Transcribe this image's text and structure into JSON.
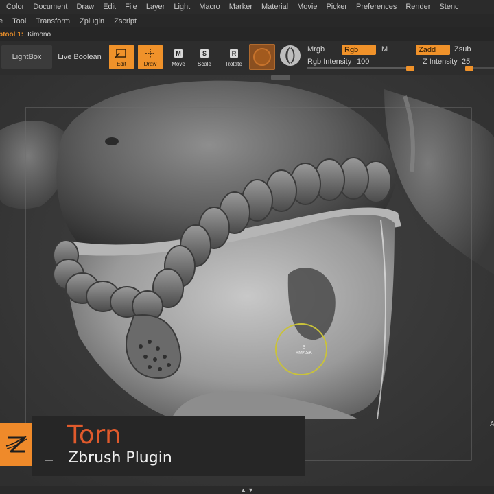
{
  "menu": {
    "items": [
      "Color",
      "Document",
      "Draw",
      "Edit",
      "File",
      "Layer",
      "Light",
      "Macro",
      "Marker",
      "Material",
      "Movie",
      "Picker",
      "Preferences",
      "Render",
      "Stenc"
    ]
  },
  "submenu": {
    "items": [
      "e",
      "Tool",
      "Transform",
      "Zplugin",
      "Zscript"
    ]
  },
  "subtool": {
    "label": "btool 1:",
    "name": "Kimono"
  },
  "toolbar": {
    "lightbox": "LightBox",
    "live_boolean": "Live Boolean",
    "edit": "Edit",
    "draw": "Draw",
    "move": "Move",
    "move_key": "M",
    "scale": "Scale",
    "scale_key": "S",
    "rotate": "Rotate",
    "rotate_key": "R",
    "mrgb": "Mrgb",
    "rgb": "Rgb",
    "m": "M",
    "zadd": "Zadd",
    "zsub": "Zsub",
    "rgb_intensity_label": "Rgb Intensity",
    "rgb_intensity_value": "100",
    "rgb_intensity_fraction": 1.0,
    "z_intensity_label": "Z Intensity",
    "z_intensity_value": "25",
    "z_intensity_fraction": 0.03
  },
  "brush": {
    "key": "S",
    "mode": "+MASK"
  },
  "title_card": {
    "title": "Torn",
    "subtitle": "Zbrush Plugin"
  },
  "right_edge_letter": "A",
  "colors": {
    "accent": "#f0922a",
    "title": "#e05a2c",
    "brush_ring": "#c9c23a"
  }
}
